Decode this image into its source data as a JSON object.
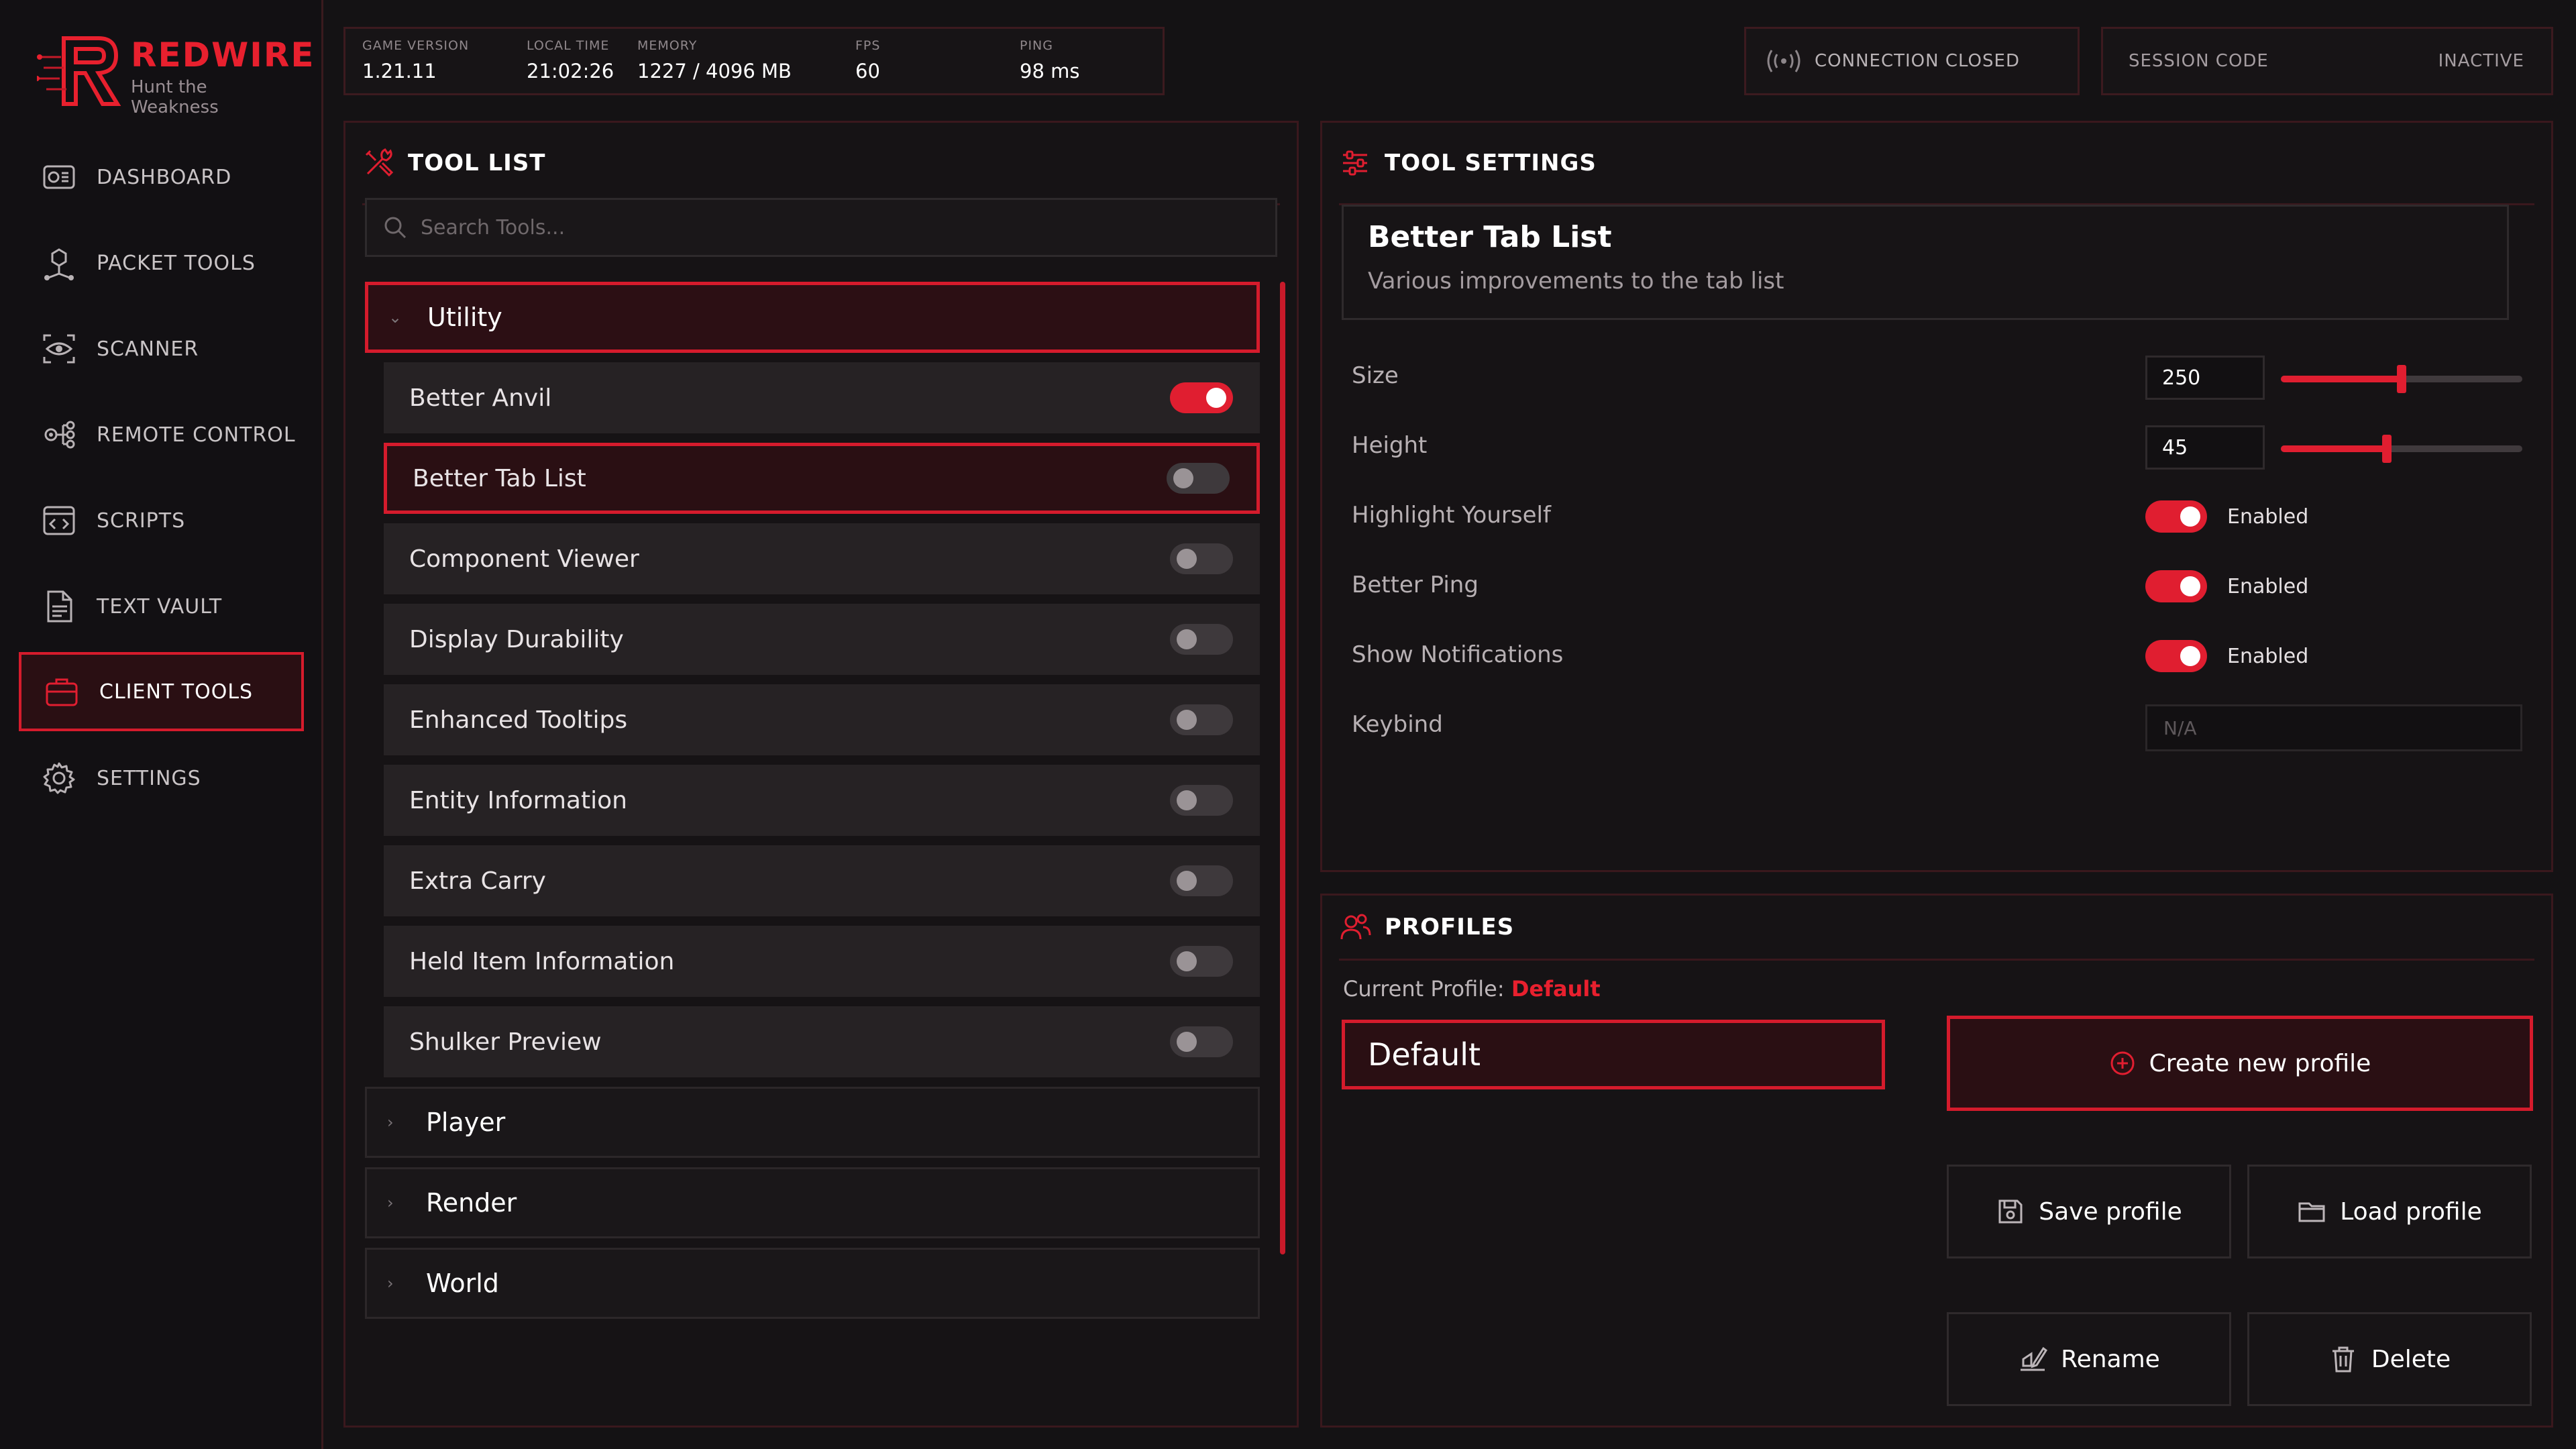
{
  "app": {
    "name": "REDWIRE",
    "tagline": "Hunt the Weakness"
  },
  "sidebar": {
    "items": [
      {
        "label": "DASHBOARD",
        "icon": "dashboard-icon"
      },
      {
        "label": "PACKET TOOLS",
        "icon": "packet-tools-icon"
      },
      {
        "label": "SCANNER",
        "icon": "scanner-icon"
      },
      {
        "label": "REMOTE CONTROL",
        "icon": "remote-control-icon"
      },
      {
        "label": "SCRIPTS",
        "icon": "scripts-icon"
      },
      {
        "label": "TEXT VAULT",
        "icon": "text-vault-icon"
      },
      {
        "label": "CLIENT TOOLS",
        "icon": "client-tools-icon",
        "active": true
      },
      {
        "label": "SETTINGS",
        "icon": "gear-icon"
      }
    ]
  },
  "stats": {
    "game_version": {
      "label": "GAME VERSION",
      "value": "1.21.11"
    },
    "local_time": {
      "label": "LOCAL TIME",
      "value": "21:02:26"
    },
    "memory": {
      "label": "MEMORY",
      "value": "1227 / 4096 MB"
    },
    "fps": {
      "label": "FPS",
      "value": "60"
    },
    "ping": {
      "label": "PING",
      "value": "98 ms"
    }
  },
  "connection": {
    "status": "CONNECTION CLOSED",
    "icon": "broadcast-icon"
  },
  "session": {
    "label": "SESSION CODE",
    "status": "INACTIVE"
  },
  "tool_list": {
    "title": "TOOL LIST",
    "search_placeholder": "Search Tools...",
    "categories": [
      {
        "label": "Utility",
        "expanded": true
      },
      {
        "label": "Player",
        "expanded": false
      },
      {
        "label": "Render",
        "expanded": false
      },
      {
        "label": "World",
        "expanded": false
      }
    ],
    "tools": [
      {
        "label": "Better Anvil",
        "enabled": true
      },
      {
        "label": "Better Tab List",
        "enabled": false,
        "selected": true
      },
      {
        "label": "Component Viewer",
        "enabled": false
      },
      {
        "label": "Display Durability",
        "enabled": false
      },
      {
        "label": "Enhanced Tooltips",
        "enabled": false
      },
      {
        "label": "Entity Information",
        "enabled": false
      },
      {
        "label": "Extra Carry",
        "enabled": false
      },
      {
        "label": "Held Item Information",
        "enabled": false
      },
      {
        "label": "Shulker Preview",
        "enabled": false
      }
    ]
  },
  "tool_settings": {
    "title": "TOOL SETTINGS",
    "tool_name": "Better Tab List",
    "tool_description": "Various improvements to the tab list",
    "size": {
      "label": "Size",
      "value": "250",
      "fraction": 0.5
    },
    "height": {
      "label": "Height",
      "value": "45",
      "fraction": 0.44
    },
    "highlight_yourself": {
      "label": "Highlight Yourself",
      "state": "Enabled"
    },
    "better_ping": {
      "label": "Better Ping",
      "state": "Enabled"
    },
    "show_notifications": {
      "label": "Show Notifications",
      "state": "Enabled"
    },
    "keybind": {
      "label": "Keybind",
      "value": "N/A"
    }
  },
  "profiles": {
    "title": "PROFILES",
    "current_label": "Current Profile:",
    "current_value": "Default",
    "items": [
      "Default"
    ],
    "create_label": "Create new profile",
    "save_label": "Save profile",
    "load_label": "Load profile",
    "rename_label": "Rename",
    "delete_label": "Delete"
  },
  "colors": {
    "accent": "#e01e30",
    "background": "#141214",
    "panel": "#161315",
    "border": "#3a181d"
  }
}
